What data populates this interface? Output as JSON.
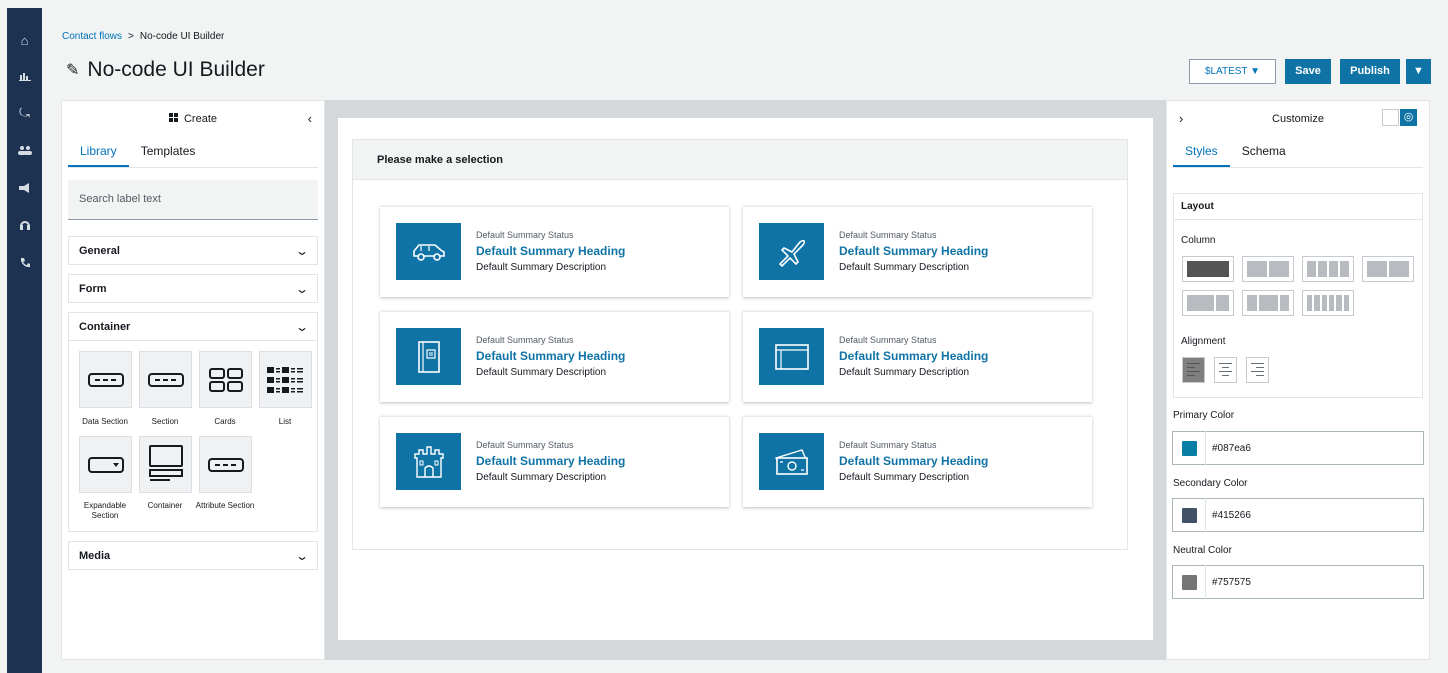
{
  "breadcrumb": {
    "parent": "Contact flows",
    "separator": ">",
    "current": "No-code UI Builder"
  },
  "page_title": "No-code UI Builder",
  "toolbar": {
    "version": "$LATEST",
    "save": "Save",
    "publish": "Publish"
  },
  "left_panel": {
    "header": "Create",
    "tabs": [
      "Library",
      "Templates"
    ],
    "search_placeholder": "Search label text",
    "sections": {
      "general": "General",
      "form": "Form",
      "container": "Container",
      "media": "Media"
    },
    "components": [
      "Data Section",
      "Section",
      "Cards",
      "List",
      "Expandable Section",
      "Container",
      "Attribute Section"
    ]
  },
  "canvas": {
    "prompt": "Please make a selection",
    "cards": [
      {
        "icon": "car-icon",
        "status": "Default Summary Status",
        "heading": "Default Summary Heading",
        "description": "Default Summary Description"
      },
      {
        "icon": "airplane-icon",
        "status": "Default Summary Status",
        "heading": "Default Summary Heading",
        "description": "Default Summary Description"
      },
      {
        "icon": "notebook-icon",
        "status": "Default Summary Status",
        "heading": "Default Summary Heading",
        "description": "Default Summary Description"
      },
      {
        "icon": "window-icon",
        "status": "Default Summary Status",
        "heading": "Default Summary Heading",
        "description": "Default Summary Description"
      },
      {
        "icon": "castle-icon",
        "status": "Default Summary Status",
        "heading": "Default Summary Heading",
        "description": "Default Summary Description"
      },
      {
        "icon": "money-icon",
        "status": "Default Summary Status",
        "heading": "Default Summary Heading",
        "description": "Default Summary Description"
      }
    ]
  },
  "right_panel": {
    "header": "Customize",
    "tabs": [
      "Styles",
      "Schema"
    ],
    "layout_title": "Layout",
    "column_label": "Column",
    "alignment_label": "Alignment",
    "primary_label": "Primary Color",
    "primary_value": "#087ea6",
    "secondary_label": "Secondary Color",
    "secondary_value": "#415266",
    "neutral_label": "Neutral Color",
    "neutral_value": "#757575"
  },
  "colors": {
    "accent": "#0f73a6",
    "rail": "#1d3251",
    "link": "#0073bb"
  }
}
